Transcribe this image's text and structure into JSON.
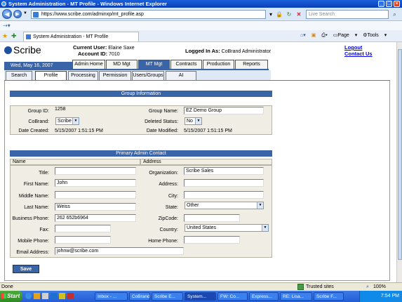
{
  "window": {
    "title": "System Administration - MT Profile - Windows Internet Explorer"
  },
  "browser": {
    "address": "https://www.scribe.com/adminxp/mt_profile.asp",
    "search_placeholder": "Live Search",
    "tab_title": "System Administration - MT Profile",
    "page_menu": "Page",
    "tools_menu": "Tools"
  },
  "header": {
    "logo_text": "Scribe",
    "current_user_label": "Current User:",
    "current_user": "Elaine Saxe",
    "account_id_label": "Account ID:",
    "account_id": "7010",
    "logged_in_label": "Logged In As:",
    "logged_in_as": "CoBrand Administrator",
    "logout": "Logout",
    "contact_us": "Contact Us",
    "date": "Wed, May 16, 2007"
  },
  "main_tabs": [
    "Admin Home",
    "MD Mgt",
    "MT Mgt",
    "Contracts",
    "Production",
    "Reports"
  ],
  "sub_tabs": [
    "Search",
    "Profile",
    "Processing",
    "Permission",
    "Users/Groups",
    "AI"
  ],
  "group_info": {
    "heading": "Group Information",
    "group_id_label": "Group ID:",
    "group_id": "1258",
    "group_name_label": "Group Name:",
    "group_name": "EZ Demo Group",
    "cobrand_label": "CoBrand:",
    "cobrand": "Scribe",
    "deleted_label": "Deleted Status:",
    "deleted": "No",
    "date_created_label": "Date Created:",
    "date_created": "5/15/2007 1:51:15 PM",
    "date_modified_label": "Date Modified:",
    "date_modified": "5/15/2007 1:51:15 PM"
  },
  "admin_contact": {
    "heading": "Primary Admin Contact",
    "name_header": "Name",
    "address_header": "Address",
    "title_label": "Title:",
    "title": "",
    "first_name_label": "First Name:",
    "first_name": "John",
    "middle_name_label": "Middle Name:",
    "middle_name": "",
    "last_name_label": "Last Name:",
    "last_name": "Weiss",
    "business_phone_label": "Business Phone:",
    "business_phone": "262 652b6964",
    "fax_label": "Fax:",
    "fax": "",
    "mobile_phone_label": "Mobile Phone:",
    "mobile_phone": "",
    "email_label": "Email Address:",
    "email": "johnw@scribe.com",
    "organization_label": "Organization:",
    "organization": "Scribe Sales",
    "address_label": "Address:",
    "address": "",
    "city_label": "City:",
    "city": "",
    "state_label": "State:",
    "state": "Other",
    "zipcode_label": "ZipCode:",
    "zipcode": "",
    "country_label": "Country:",
    "country": "United States",
    "home_phone_label": "Home Phone:",
    "home_phone": ""
  },
  "save_label": "Save",
  "status": {
    "left": "Done",
    "zone": "Trusted sites",
    "zoom": "100%"
  },
  "taskbar": {
    "start": "Start",
    "items": [
      "Inbox - ...",
      "CoBrand",
      "Scribe E...",
      "System...",
      "FW: Co...",
      "Express...",
      "RE: Lisa...",
      "Scribe F..."
    ],
    "clock": "7:54 PM"
  }
}
